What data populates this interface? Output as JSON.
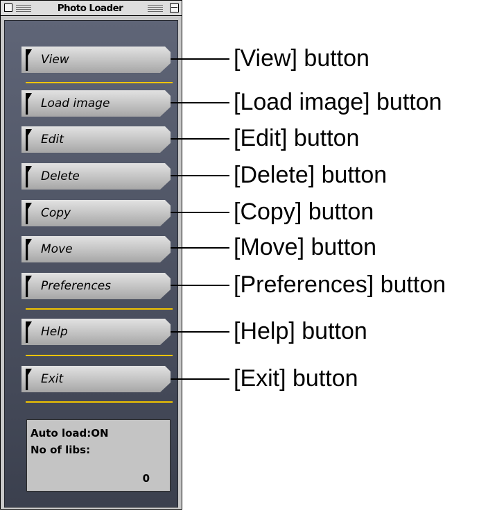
{
  "window": {
    "title": "Photo Loader"
  },
  "buttons": [
    {
      "label": "View"
    },
    {
      "label": "Load image"
    },
    {
      "label": "Edit"
    },
    {
      "label": "Delete"
    },
    {
      "label": "Copy"
    },
    {
      "label": "Move"
    },
    {
      "label": "Preferences"
    },
    {
      "label": "Help"
    },
    {
      "label": "Exit"
    }
  ],
  "status": {
    "auto_load": "Auto load:ON",
    "libs_label": "No of libs:",
    "libs_value": "0"
  },
  "callouts": [
    "[View] button",
    "[Load image] button",
    "[Edit] button",
    "[Delete] button",
    "[Copy] button",
    "[Move] button",
    "[Preferences] button",
    "[Help] button",
    "[Exit] button"
  ],
  "colors": {
    "panel": "#4b5060",
    "separator": "#f0c400",
    "button_face": "#c2c2c2"
  }
}
